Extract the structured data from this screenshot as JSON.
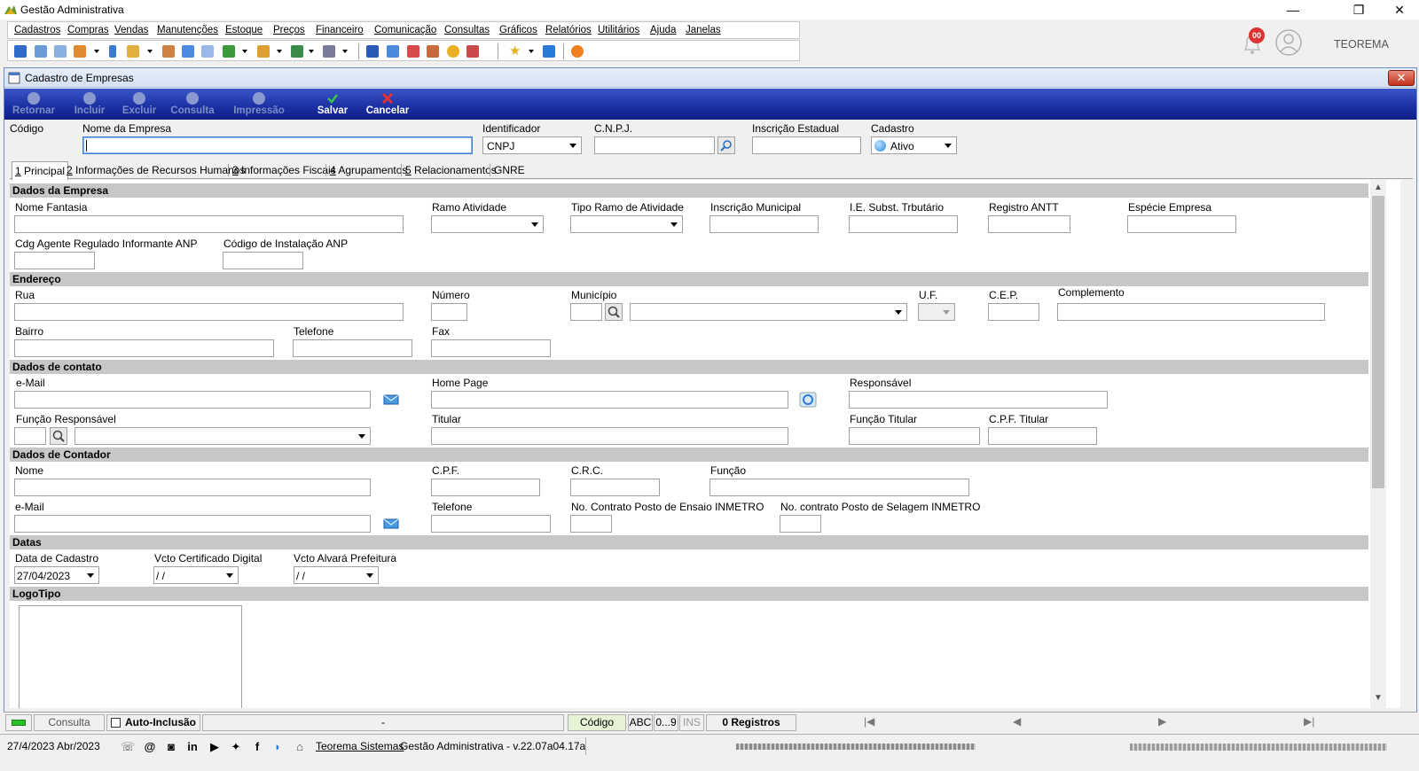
{
  "app": {
    "title": "Gestão Administrativa",
    "user_name": "TEOREMA",
    "notification_count": "00"
  },
  "window_controls": {
    "minimize": "—",
    "restore": "❐",
    "close": "✕"
  },
  "menu": [
    "Cadastros",
    "Compras",
    "Vendas",
    "Manutenções",
    "Estoque",
    "Preços",
    "Financeiro",
    "Comunicação",
    "Consultas",
    "Gráficos",
    "Relatórios",
    "Utilitários",
    "Ajuda",
    "Janelas"
  ],
  "child_window": {
    "title": "Cadastro de Empresas",
    "close": "✕"
  },
  "actions": [
    {
      "label": "Retornar",
      "enabled": false
    },
    {
      "label": "Incluir",
      "enabled": false
    },
    {
      "label": "Excluir",
      "enabled": false
    },
    {
      "label": "Consulta",
      "enabled": false
    },
    {
      "label": "Impressão",
      "enabled": false
    },
    {
      "label": "Salvar",
      "enabled": true
    },
    {
      "label": "Cancelar",
      "enabled": true
    }
  ],
  "header": {
    "codigo_label": "Código",
    "nome_label": "Nome da Empresa",
    "nome_value": "",
    "identificador_label": "Identificador",
    "identificador_value": "CNPJ",
    "cnpj_label": "C.N.P.J.",
    "ie_label": "Inscrição Estadual",
    "cadastro_label": "Cadastro",
    "cadastro_value": "Ativo"
  },
  "tabs": [
    {
      "num": "1",
      "label": " Principal"
    },
    {
      "num": "2",
      "label": " Informações de Recursos Humanos"
    },
    {
      "num": "3",
      "label": " Informações Fiscais"
    },
    {
      "num": "4",
      "label": " Agrupamentos"
    },
    {
      "num": "5",
      "label": " Relacionamentos"
    },
    {
      "num": "",
      "label": "GNRE"
    }
  ],
  "sections": {
    "empresa": "Dados da Empresa",
    "endereco": "Endereço",
    "contato": "Dados de contato",
    "contador": "Dados de Contador",
    "datas": "Datas",
    "logo": "LogoTipo"
  },
  "empresa": {
    "nome_fantasia": "Nome Fantasia",
    "ramo": "Ramo Atividade",
    "tipo_ramo": "Tipo Ramo de Atividade",
    "insc_municipal": "Inscrição Municipal",
    "ie_subst": "I.E. Subst. Trbutário",
    "antt": "Registro ANTT",
    "especie": "Espécie Empresa",
    "anp_agente": "Cdg Agente Regulado Informante ANP",
    "anp_instalacao": "Código de Instalação ANP"
  },
  "endereco": {
    "rua": "Rua",
    "numero": "Número",
    "municipio": "Município",
    "uf": "U.F.",
    "cep": "C.E.P.",
    "complemento": "Complemento",
    "bairro": "Bairro",
    "telefone": "Telefone",
    "fax": "Fax"
  },
  "contato": {
    "email": "e-Mail",
    "homepage": "Home Page",
    "responsavel": "Responsável",
    "funcao_resp": "Função Responsável",
    "titular": "Titular",
    "funcao_titular": "Função Titular",
    "cpf_titular": "C.P.F. Titular"
  },
  "contador": {
    "nome": "Nome",
    "cpf": "C.P.F.",
    "crc": "C.R.C.",
    "funcao": "Função",
    "email": "e-Mail",
    "telefone": "Telefone",
    "ensaio": "No. Contrato Posto de Ensaio INMETRO",
    "selagem": "No. contrato Posto de Selagem INMETRO"
  },
  "datas": {
    "cadastro_label": "Data de Cadastro",
    "cadastro_value": "27/04/2023",
    "certificado_label": "Vcto Certificado Digital",
    "certificado_value": " /  /",
    "alvara_label": "Vcto Alvará Prefeitura",
    "alvara_value": " /  /"
  },
  "statusbar": {
    "mode": "Consulta",
    "auto_inclusao": "Auto-Inclusão",
    "dash": "-",
    "codigo": "Código",
    "abc": "ABC",
    "num": "0...9",
    "ins": "INS",
    "registros": "0 Registros",
    "first": "|◀",
    "prev": "◀",
    "next": "▶",
    "last": "▶|"
  },
  "infobar": {
    "date": "27/4/2023 Abr/2023",
    "company_link": "Teorema Sistemas",
    "version": "Gestão Administrativa - v.22.07a04.17a"
  },
  "colors": {
    "action_bar": "#1a2fa2",
    "section_header": "#c7c7c7",
    "focus_border": "#3c7fd6"
  }
}
